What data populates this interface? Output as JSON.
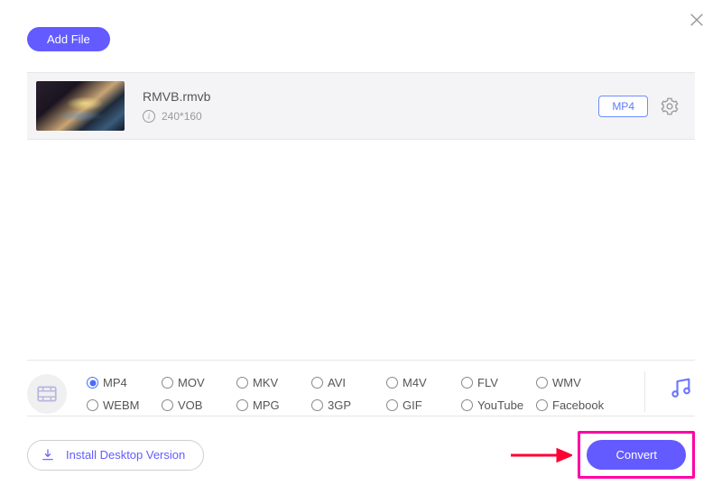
{
  "buttons": {
    "add_file": "Add File",
    "install": "Install Desktop Version",
    "convert": "Convert"
  },
  "file": {
    "name": "RMVB.rmvb",
    "resolution": "240*160",
    "format_tag": "MP4"
  },
  "formats": {
    "selected": "MP4",
    "row1": [
      "MP4",
      "MOV",
      "MKV",
      "AVI",
      "M4V",
      "FLV",
      "WMV"
    ],
    "row2": [
      "WEBM",
      "VOB",
      "MPG",
      "3GP",
      "GIF",
      "YouTube",
      "Facebook"
    ]
  }
}
